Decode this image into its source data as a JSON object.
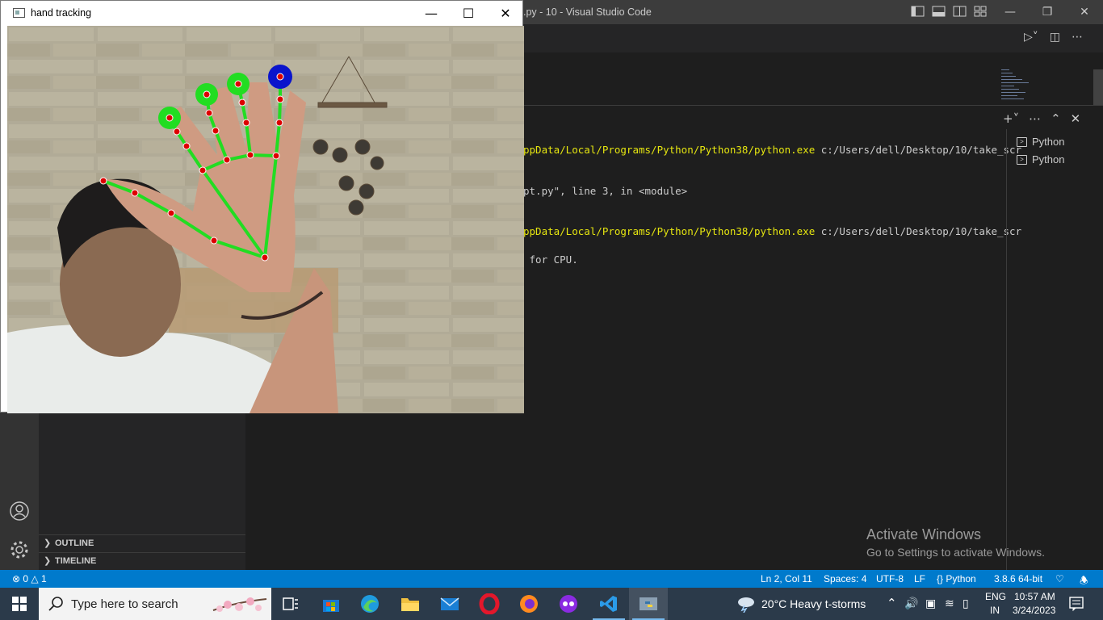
{
  "vscode": {
    "title": ".py - 10 - Visual Studio Code",
    "terminal_lines": [
      {
        "pre": "",
        "yellow": "ppData/Local/Programs/Python/Python38/python.exe",
        "post": " c:/Users/dell/Desktop/10/take_scr"
      },
      {
        "pre": "pt.py\", line 3, in <module>",
        "yellow": "",
        "post": ""
      },
      {
        "pre": "",
        "yellow": "ppData/Local/Programs/Python/Python38/python.exe",
        "post": " c:/Users/dell/Desktop/10/take_scr"
      },
      {
        "pre": " for CPU.",
        "yellow": "",
        "post": ""
      }
    ],
    "terminal_list": [
      "Python",
      "Python"
    ],
    "sidebar_sections": [
      "OUTLINE",
      "TIMELINE"
    ],
    "activate": {
      "line1": "Activate Windows",
      "line2": "Go to Settings to activate Windows."
    },
    "status": {
      "errors": "0",
      "warnings": "1",
      "position": "Ln 2, Col 11",
      "spaces": "Spaces: 4",
      "encoding": "UTF-8",
      "eol": "LF",
      "language": "Python",
      "interpreter": "3.8.6 64-bit"
    }
  },
  "cv_window": {
    "title": "hand tracking"
  },
  "taskbar": {
    "search_placeholder": "Type here to search",
    "weather": "20°C  Heavy t-storms",
    "lang_line1": "ENG",
    "lang_line2": "IN",
    "time": "10:57 AM",
    "date": "3/24/2023"
  }
}
